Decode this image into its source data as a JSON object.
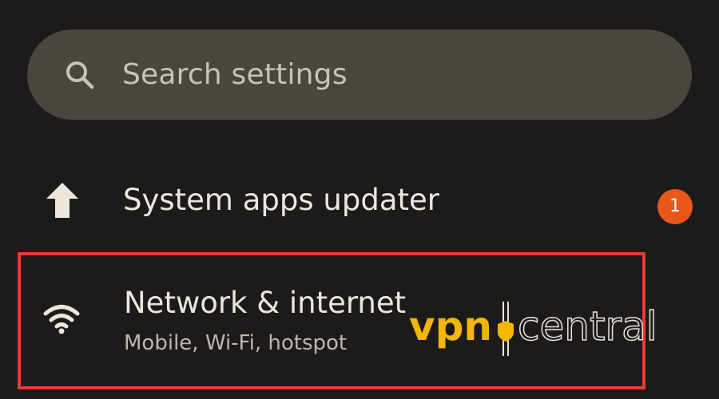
{
  "search": {
    "placeholder": "Search settings"
  },
  "items": [
    {
      "id": "system-apps-updater",
      "icon": "arrow-up-icon",
      "title": "System apps updater",
      "badge": "1"
    },
    {
      "id": "network-internet",
      "icon": "wifi-icon",
      "title": "Network & internet",
      "subtitle": "Mobile, Wi-Fi, hotspot",
      "highlighted": true
    }
  ],
  "watermark": {
    "brand_left": "vpn",
    "brand_right": "central"
  },
  "colors": {
    "background": "#1c1b19",
    "search_bar": "#4a463f",
    "badge": "#e8561a",
    "highlight": "#e53d33",
    "watermark_yellow": "#f2b705"
  }
}
